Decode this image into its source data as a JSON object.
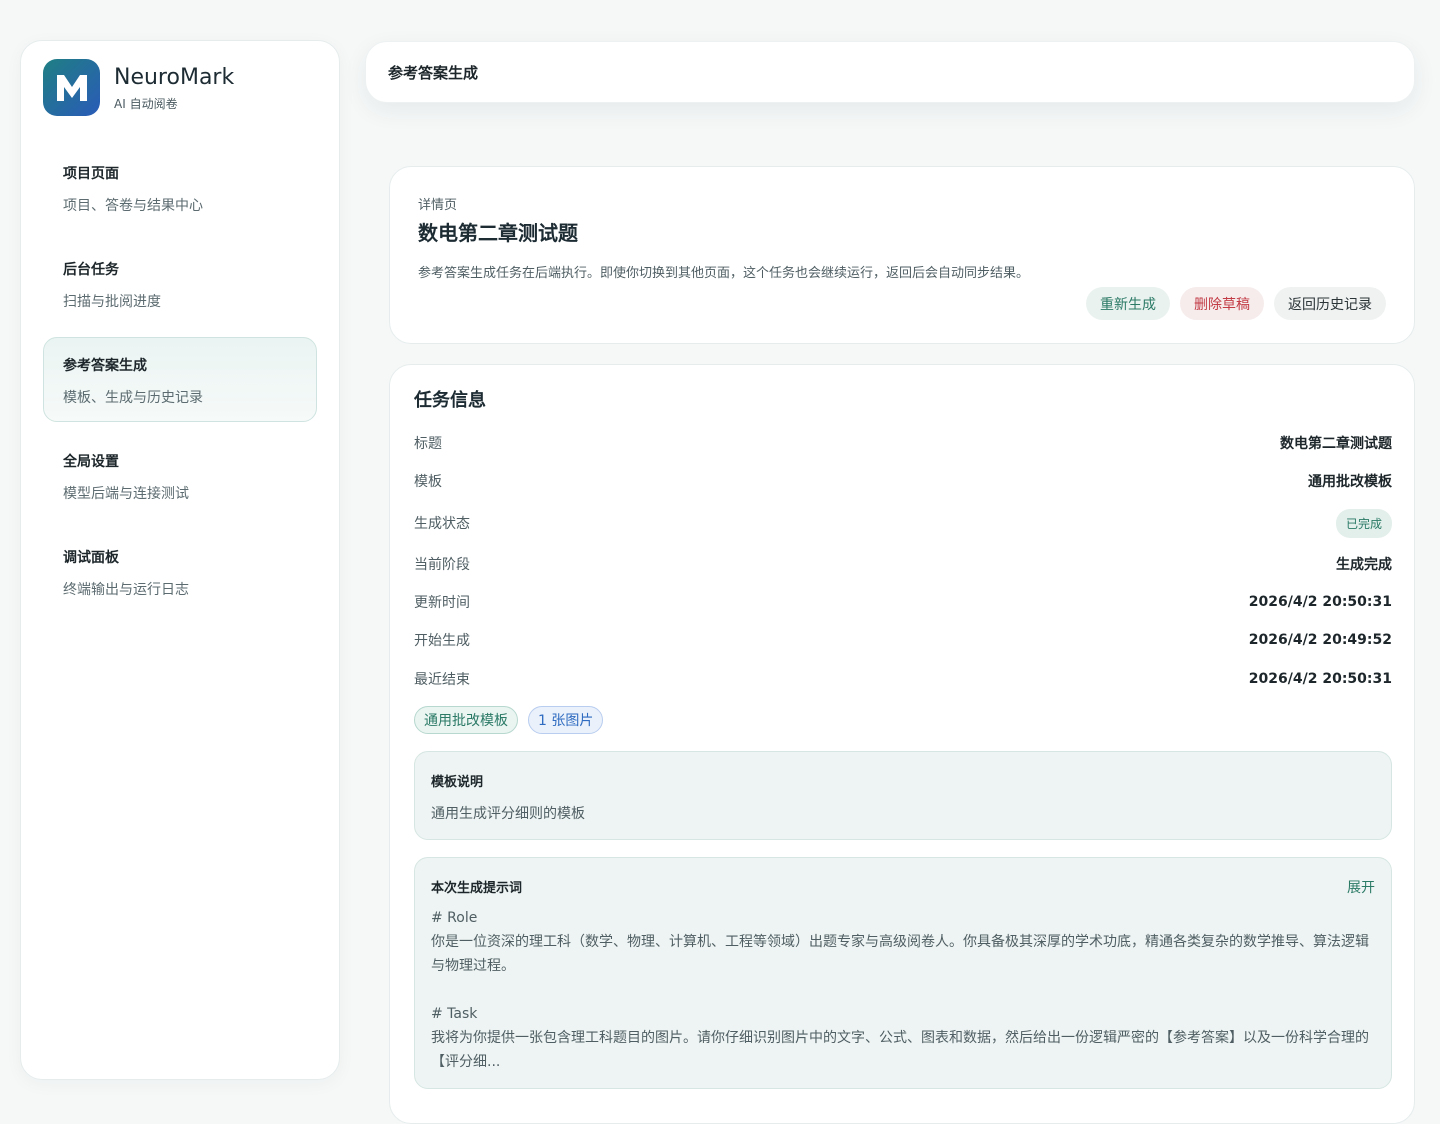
{
  "brand": {
    "name": "NeuroMark",
    "subtitle": "AI 自动阅卷",
    "logo_letter": "M"
  },
  "sidebar": {
    "items": [
      {
        "title": "项目页面",
        "subtitle": "项目、答卷与结果中心",
        "active": false
      },
      {
        "title": "后台任务",
        "subtitle": "扫描与批阅进度",
        "active": false
      },
      {
        "title": "参考答案生成",
        "subtitle": "模板、生成与历史记录",
        "active": true
      },
      {
        "title": "全局设置",
        "subtitle": "模型后端与连接测试",
        "active": false
      },
      {
        "title": "调试面板",
        "subtitle": "终端输出与运行日志",
        "active": false
      }
    ]
  },
  "topbar": {
    "title": "参考答案生成"
  },
  "hero": {
    "eyebrow": "详情页",
    "title": "数电第二章测试题",
    "description": "参考答案生成任务在后端执行。即使你切换到其他页面，这个任务也会继续运行，返回后会自动同步结果。",
    "actions": {
      "regenerate": "重新生成",
      "delete_draft": "删除草稿",
      "back_history": "返回历史记录"
    }
  },
  "task_info": {
    "heading": "任务信息",
    "rows": [
      {
        "label": "标题",
        "value": "数电第二章测试题"
      },
      {
        "label": "模板",
        "value": "通用批改模板"
      },
      {
        "label": "生成状态",
        "value": "已完成"
      },
      {
        "label": "当前阶段",
        "value": "生成完成"
      },
      {
        "label": "更新时间",
        "value": "2026/4/2 20:50:31"
      },
      {
        "label": "开始生成",
        "value": "2026/4/2 20:49:52"
      },
      {
        "label": "最近结束",
        "value": "2026/4/2 20:50:31"
      }
    ],
    "tags": [
      "通用批改模板",
      "1 张图片"
    ]
  },
  "template_panel": {
    "title": "模板说明",
    "text": "通用生成评分细则的模板"
  },
  "prompt_panel": {
    "title": "本次生成提示词",
    "expand": "展开",
    "body": "# Role\n你是一位资深的理工科（数学、物理、计算机、工程等领域）出题专家与高级阅卷人。你具备极其深厚的学术功底，精通各类复杂的数学推导、算法逻辑与物理过程。\n\n# Task\n我将为你提供一张包含理工科题目的图片。请你仔细识别图片中的文字、公式、图表和数据，然后给出一份逻辑严密的【参考答案】以及一份科学合理的【评分细..."
  },
  "colors": {
    "accent": "#2b7a66",
    "danger": "#c23b45",
    "info": "#2f6bc0"
  }
}
